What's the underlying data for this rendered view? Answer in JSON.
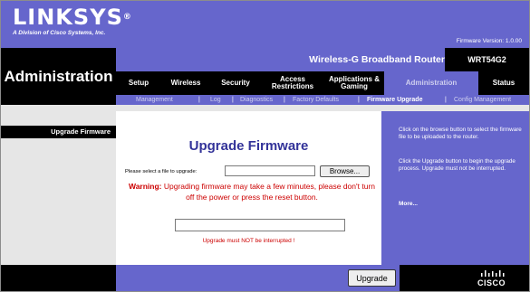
{
  "brand": {
    "logo": "LINKSYS",
    "registered": "®",
    "tagline": "A Division of Cisco Systems, Inc.",
    "firmware_version": "Firmware Version: 1.0.00",
    "product_name": "Wireless-G Broadband Router",
    "model": "WRT54G2",
    "footer_logo": "CISCO"
  },
  "page_title": "Administration",
  "tabs": [
    {
      "label": "Setup"
    },
    {
      "label": "Wireless"
    },
    {
      "label": "Security"
    },
    {
      "label": "Access Restrictions"
    },
    {
      "label": "Applications & Gaming"
    },
    {
      "label": "Administration",
      "active": true
    },
    {
      "label": "Status"
    }
  ],
  "subtabs": [
    {
      "label": "Management"
    },
    {
      "label": "Log"
    },
    {
      "label": "Diagnostics"
    },
    {
      "label": "Factory Defaults"
    },
    {
      "label": "Firmware Upgrade",
      "active": true
    },
    {
      "label": "Config Management"
    }
  ],
  "section_label": "Upgrade Firmware",
  "main": {
    "heading": "Upgrade Firmware",
    "select_label": "Please select a file to upgrade:",
    "file_value": "",
    "browse_label": "Browse...",
    "warning_prefix": "Warning:",
    "warning_text": "Upgrading firmware may take a few minutes, please don't turn off the power or press the reset button.",
    "progress_text": "",
    "notice": "Upgrade must NOT be interrupted !",
    "upgrade_button": "Upgrade"
  },
  "help": {
    "paragraph1": "Click on the browse button to select the firmware file to be uploaded to the router.",
    "paragraph2": "Click the Upgrade button to begin the upgrade process. Upgrade must not be interrupted.",
    "more": "More..."
  },
  "colors": {
    "accent": "#6666cc",
    "dark": "#000000",
    "warning": "#cc0000",
    "heading": "#333399"
  }
}
